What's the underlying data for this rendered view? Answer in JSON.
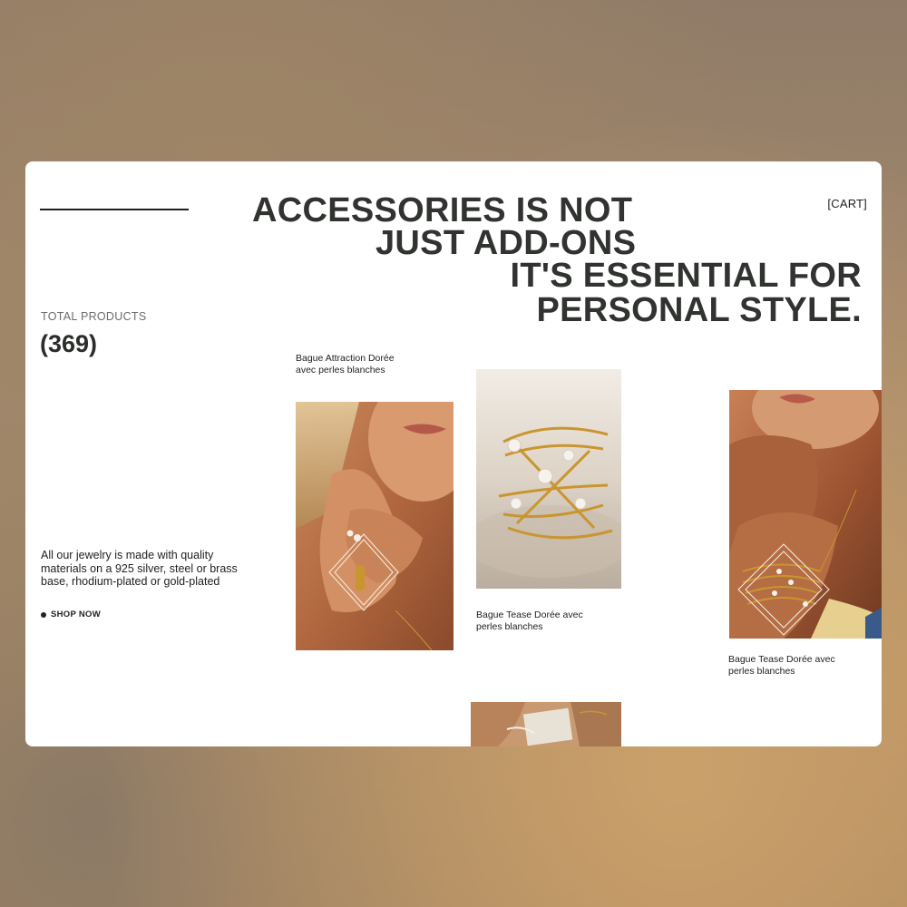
{
  "header": {
    "cart_label": "[CART]",
    "headline": [
      "ACCESSORIES IS NOT",
      "JUST ADD-ONS",
      "IT'S ESSENTIAL FOR",
      "PERSONAL STYLE."
    ]
  },
  "stats": {
    "label": "TOTAL PRODUCTS",
    "count": "(369)"
  },
  "intro": {
    "description": "All our jewelry is made with quality materials on a 925 silver, steel or brass base, rhodium-plated or gold-plated",
    "cta_label": "SHOP NOW"
  },
  "products": [
    {
      "caption": "Bague Attraction Dorée avec perles blanches",
      "image": "model-hand-rings-photo"
    },
    {
      "caption": "Bague Tease Dorée avec perles blanches",
      "image": "gold-pearl-ring-on-sand-photo"
    },
    {
      "caption": "Bague Tease Dorée avec perles blanches",
      "image": "model-wrist-bracelet-photo"
    },
    {
      "caption": "",
      "image": "hands-partial-photo"
    }
  ],
  "colors": {
    "text_dark": "#2b2d2b",
    "card_bg": "#ffffff",
    "page_bg": "#a88c6e",
    "gold": "#c9952f"
  }
}
